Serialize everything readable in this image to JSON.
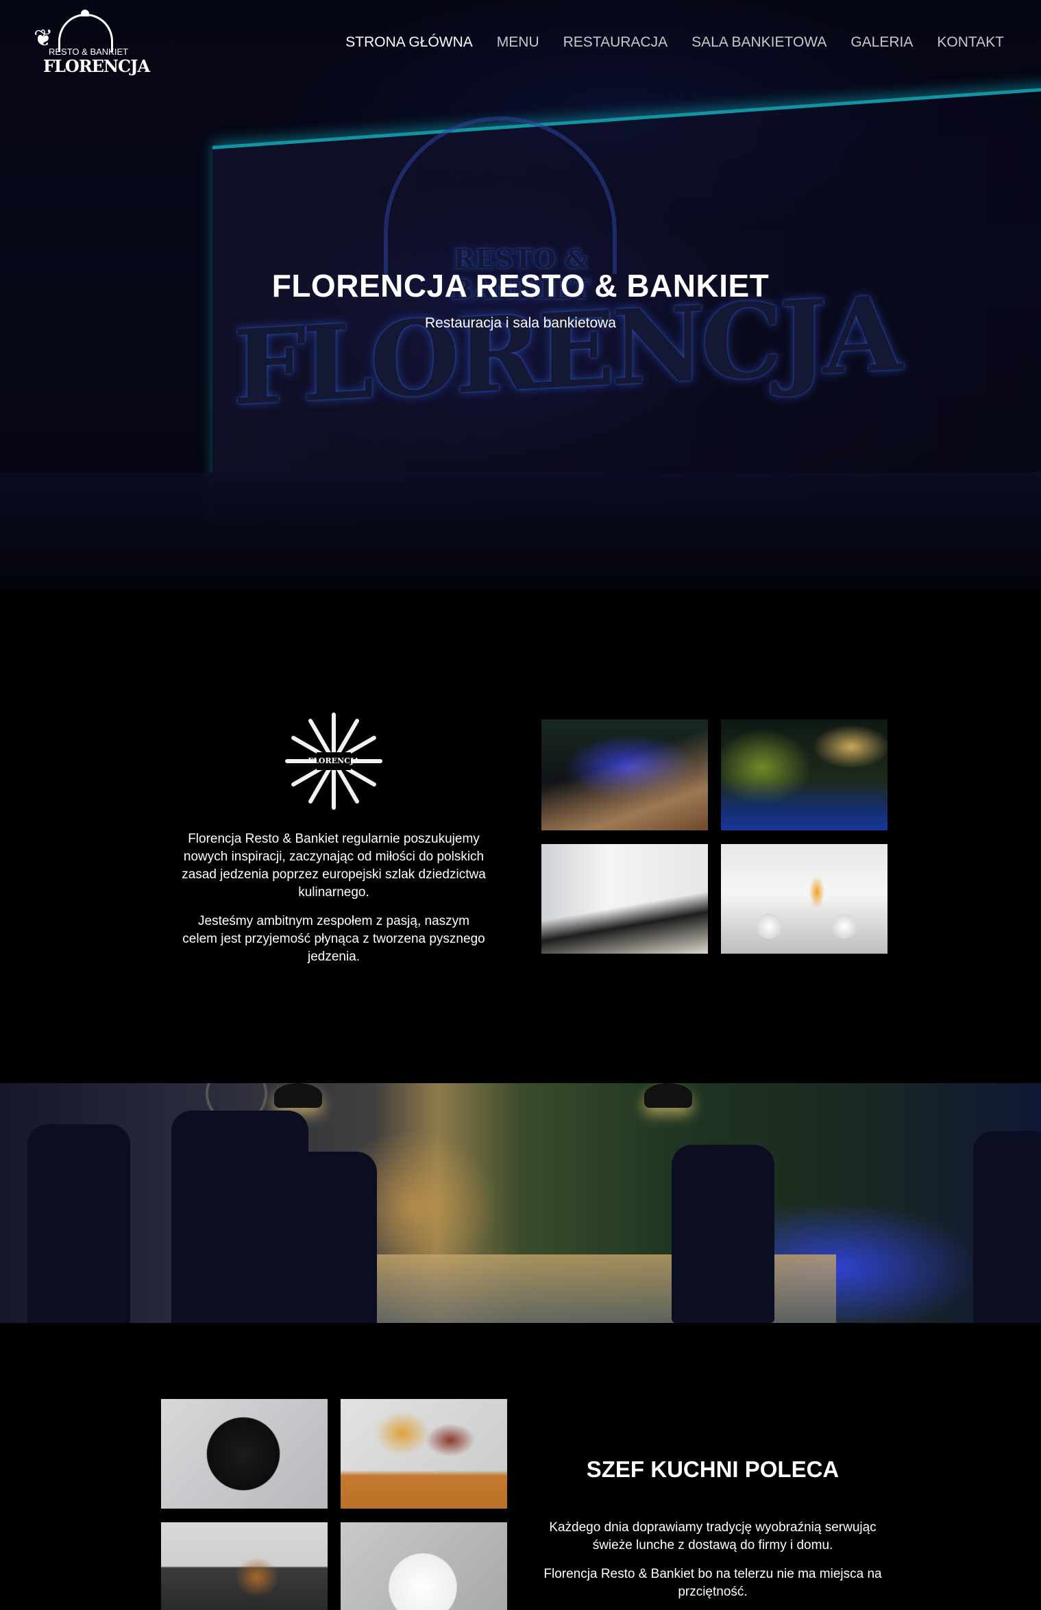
{
  "logo": {
    "line1": "RESTO & BANKIET",
    "line2": "FLORENCJA"
  },
  "nav": [
    {
      "label": "STRONA GŁÓWNA",
      "active": true
    },
    {
      "label": "MENU",
      "active": false
    },
    {
      "label": "RESTAURACJA",
      "active": false
    },
    {
      "label": "SALA BANKIETOWA",
      "active": false
    },
    {
      "label": "GALERIA",
      "active": false
    },
    {
      "label": "KONTAKT",
      "active": false
    }
  ],
  "hero": {
    "title": "FLORENCJA RESTO & BANKIET",
    "subtitle": "Restauracja i sala bankietowa",
    "sign_word": "FLORENCJA",
    "sign_sub": "RESTO & BANKIET"
  },
  "about": {
    "emblem_text": "FLORENCJA",
    "paragraphs": [
      "Florencja Resto & Bankiet regularnie poszukujemy nowych inspiracji, zaczynając od miłości do polskich zasad jedzenia poprzez europejski szlak dziedzictwa kulinarnego.",
      "Jesteśmy ambitnym zespołem z pasją, naszym celem jest przyjemość płynąca z tworzena pysznego jedzenia."
    ]
  },
  "chef": {
    "title": "SZEF KUCHNI POLECA",
    "paragraphs": [
      "Każdego dnia doprawiamy tradycję wyobraźnią serwując świeże lunche z dostawą do firmy i domu.",
      "Florencja Resto & Bankiet bo na telerzu nie ma miejsca na przciętność."
    ]
  },
  "colors": {
    "background": "#000000",
    "accent_neon": "#18c6d9",
    "nav_text": "#c9c9c9",
    "text": "#ffffff"
  }
}
